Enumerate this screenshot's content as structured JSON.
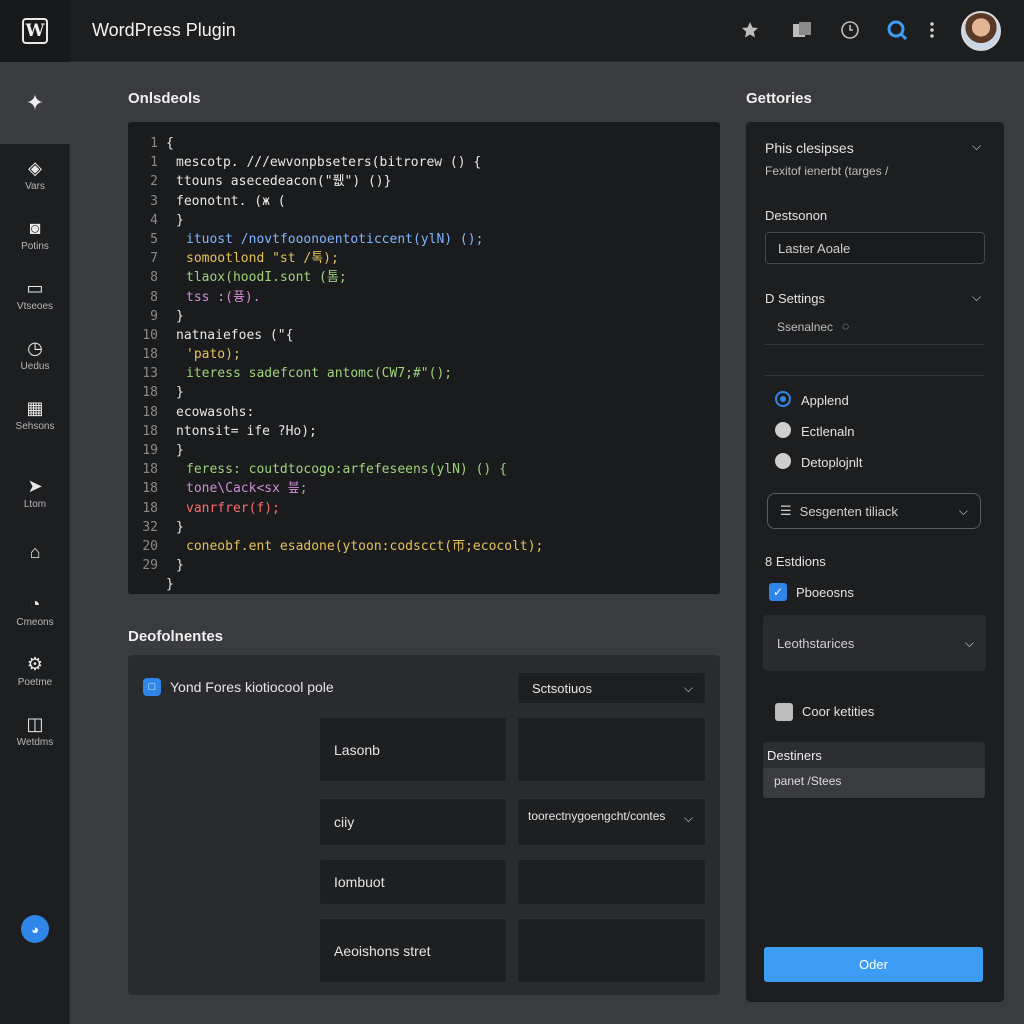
{
  "app": {
    "title": "WordPress Plugin",
    "logo_letter": "W"
  },
  "topbar": {
    "icons": [
      "star-icon",
      "copy-icon",
      "clock-icon",
      "search-icon",
      "more-icon"
    ]
  },
  "sidebar": {
    "items": [
      {
        "label": "Vars",
        "icon": "shield-icon"
      },
      {
        "label": "Potins",
        "icon": "camera-icon"
      },
      {
        "label": "Vtseoes",
        "icon": "monitor-icon"
      },
      {
        "label": "Uedus",
        "icon": "clock-icon"
      },
      {
        "label": "Sehsons",
        "icon": "bookmark-icon"
      },
      {
        "label": "Ltom",
        "icon": "send-icon"
      },
      {
        "label": "",
        "icon": "home-icon"
      },
      {
        "label": "Cmeons",
        "icon": "gauge-icon"
      },
      {
        "label": "Poetme",
        "icon": "gear-icon"
      },
      {
        "label": "Wetdms",
        "icon": "toolbox-icon"
      }
    ]
  },
  "code_section": {
    "title": "Onlsdeols",
    "lines": [
      {
        "n": "1",
        "indent": 0,
        "text": "{"
      },
      {
        "n": "1",
        "indent": 1,
        "text": "mescotp. ///ewvonpbseters(bitrorew () {"
      },
      {
        "n": "2",
        "indent": 1,
        "text": "ttouns asecedeacon(\"퓂\") ()}"
      },
      {
        "n": "3",
        "indent": 1,
        "text": "feonotnt. (ж ("
      },
      {
        "n": "4",
        "indent": 1,
        "text": "}"
      },
      {
        "n": "5",
        "indent": 2,
        "text": "ituost /novtfooonoentoticcent(ylN) ();"
      },
      {
        "n": "7",
        "indent": 2,
        "text": "somootlond \"st /톡);"
      },
      {
        "n": "8",
        "indent": 2,
        "text": "tlaox(hoodI.sont (톰;"
      },
      {
        "n": "8",
        "indent": 2,
        "text": "tss :(퓽)."
      },
      {
        "n": "9",
        "indent": 1,
        "text": "}"
      },
      {
        "n": "10",
        "indent": 1,
        "text": "natnaiefoes (\"{"
      },
      {
        "n": "18",
        "indent": 2,
        "text": "'pato);"
      },
      {
        "n": "13",
        "indent": 2,
        "text": "iteress sadefcont antomc(CW7;#\"();"
      },
      {
        "n": "18",
        "indent": 1,
        "text": "}"
      },
      {
        "n": "18",
        "indent": 1,
        "text": "ecowasohs:"
      },
      {
        "n": "18",
        "indent": 1,
        "text": "ntonsit= ife ?Ho);"
      },
      {
        "n": "19",
        "indent": 1,
        "text": "}"
      },
      {
        "n": "18",
        "indent": 2,
        "text": "feress: coutdtocogo:arfefeseens(ylN) () {"
      },
      {
        "n": "18",
        "indent": 2,
        "text": "tone\\Cack<sx 븦;"
      },
      {
        "n": "18",
        "indent": 2,
        "text": "vanrfrer(f);"
      },
      {
        "n": "32",
        "indent": 1,
        "text": "}"
      },
      {
        "n": "20",
        "indent": 2,
        "text": "coneobf.ent esadone(ytoon:codscct(帀;ecocolt);"
      },
      {
        "n": "29",
        "indent": 1,
        "text": "}"
      },
      {
        "n": "",
        "indent": 0,
        "text": "}"
      }
    ]
  },
  "dev_section": {
    "title": "Deofolnentes",
    "checkbox_label": "Yond Fores kiotiocool pole",
    "select_value": "Sctsotiuos",
    "rows": [
      {
        "left": "Lasonb",
        "right": ""
      },
      {
        "left": "ciiy",
        "right": "toorectnygoengcht/contes"
      },
      {
        "left": "Iombuot",
        "right": ""
      },
      {
        "left": "Aeoishons stret",
        "right": ""
      }
    ]
  },
  "right_section": {
    "title": "Gettories",
    "dropdown_title": "Phis clesipses",
    "dropdown_sub": "Fexitof ienerbt (targes /",
    "destination_label": "Destsonon",
    "destination_placeholder": "Laster Aoale",
    "settings_label": "D Settings",
    "settings_value": "Ssenalnec",
    "radios": [
      {
        "label": "Applend",
        "checked": true
      },
      {
        "label": "Ectlenaln",
        "checked": false
      },
      {
        "label": "Detoplojnlt",
        "checked": false
      }
    ],
    "select_label": "Sesgenten tiliack",
    "status_label": "8 Estdions",
    "check_on_label": "Pboeosns",
    "dropdown2_label": "Leothstarices",
    "check_off_label": "Coor ketities",
    "destiners_title": "Destiners",
    "destiners_value": "panet /Stees",
    "primary_button": "Oder"
  }
}
